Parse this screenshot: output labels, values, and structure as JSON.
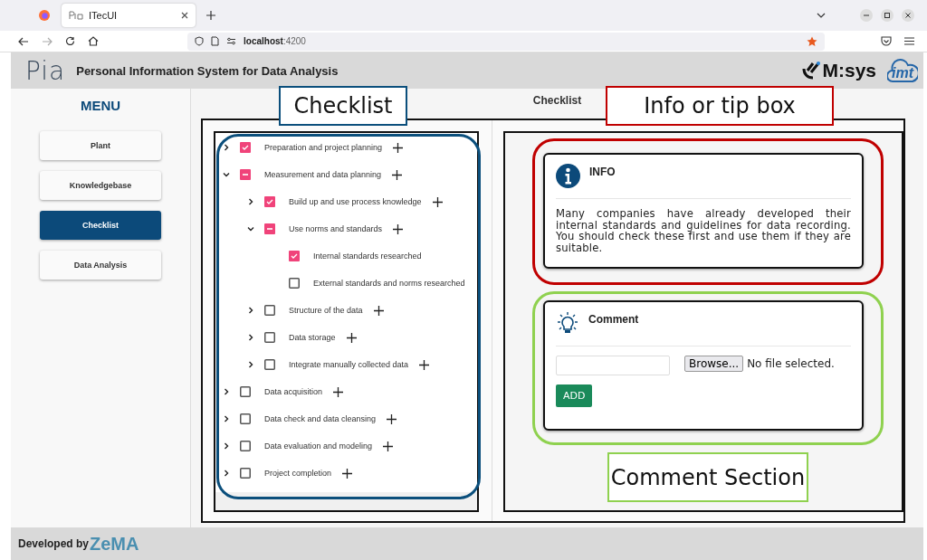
{
  "browser": {
    "tab_title": "ITecUI",
    "url_host": "localhost",
    "url_port": ":4200",
    "bookmarked": true
  },
  "header": {
    "logo": "Pia",
    "title": "Personal Information System for Data Analysis",
    "partner_logos": [
      "M:sys",
      "imt"
    ]
  },
  "menu": {
    "title": "MENU",
    "items": [
      {
        "label": "Plant",
        "selected": false
      },
      {
        "label": "Knowledgebase",
        "selected": false
      },
      {
        "label": "Checklist",
        "selected": true
      },
      {
        "label": "Data Analysis",
        "selected": false
      }
    ]
  },
  "page_title": "Checklist",
  "tree": [
    {
      "label": "Preparation and project planning",
      "checked": true,
      "indeterminate": false,
      "expanded": false
    },
    {
      "label": "Measurement and data planning",
      "checked": false,
      "indeterminate": true,
      "expanded": true,
      "children": [
        {
          "label": "Build up and use process knowledge",
          "checked": true,
          "indeterminate": false,
          "expanded": false
        },
        {
          "label": "Use norms and standards",
          "checked": false,
          "indeterminate": true,
          "expanded": true,
          "children": [
            {
              "label": "Internal standards researched",
              "checked": true,
              "indeterminate": false
            },
            {
              "label": "External standards and norms researched",
              "checked": false,
              "indeterminate": false
            }
          ]
        },
        {
          "label": "Structure of the data",
          "checked": false,
          "indeterminate": false,
          "expanded": false
        },
        {
          "label": "Data storage",
          "checked": false,
          "indeterminate": false,
          "expanded": false
        },
        {
          "label": "Integrate manually collected data",
          "checked": false,
          "indeterminate": false,
          "expanded": false
        }
      ]
    },
    {
      "label": "Data acquisition",
      "checked": false,
      "indeterminate": false,
      "expanded": false
    },
    {
      "label": "Data check and data cleansing",
      "checked": false,
      "indeterminate": false,
      "expanded": false
    },
    {
      "label": "Data evaluation and modeling",
      "checked": false,
      "indeterminate": false,
      "expanded": false
    },
    {
      "label": "Project completion",
      "checked": false,
      "indeterminate": false,
      "expanded": false
    }
  ],
  "info": {
    "title": "INFO",
    "text": "Many companies have already developed their internal standards and guidelines for data recording. You should check these first and use them if they are suitable."
  },
  "comment": {
    "title": "Comment",
    "browse_button": "Browse...",
    "file_status": "No file selected.",
    "add_button": "ADD"
  },
  "footer": {
    "text": "Developed by",
    "logo": "ZeMA"
  },
  "annotations": [
    {
      "kind": "outline",
      "color": "#0b4f7c"
    },
    {
      "kind": "outline",
      "color": "#c00000"
    },
    {
      "kind": "outline",
      "color": "#8fd14f"
    },
    {
      "kind": "label",
      "color": "#0b4f7c",
      "text": "Checklist"
    },
    {
      "kind": "label",
      "color": "#c00000",
      "text": "Info or tip box"
    },
    {
      "kind": "label",
      "color": "#8fd14f",
      "text": "Comment Section"
    }
  ]
}
